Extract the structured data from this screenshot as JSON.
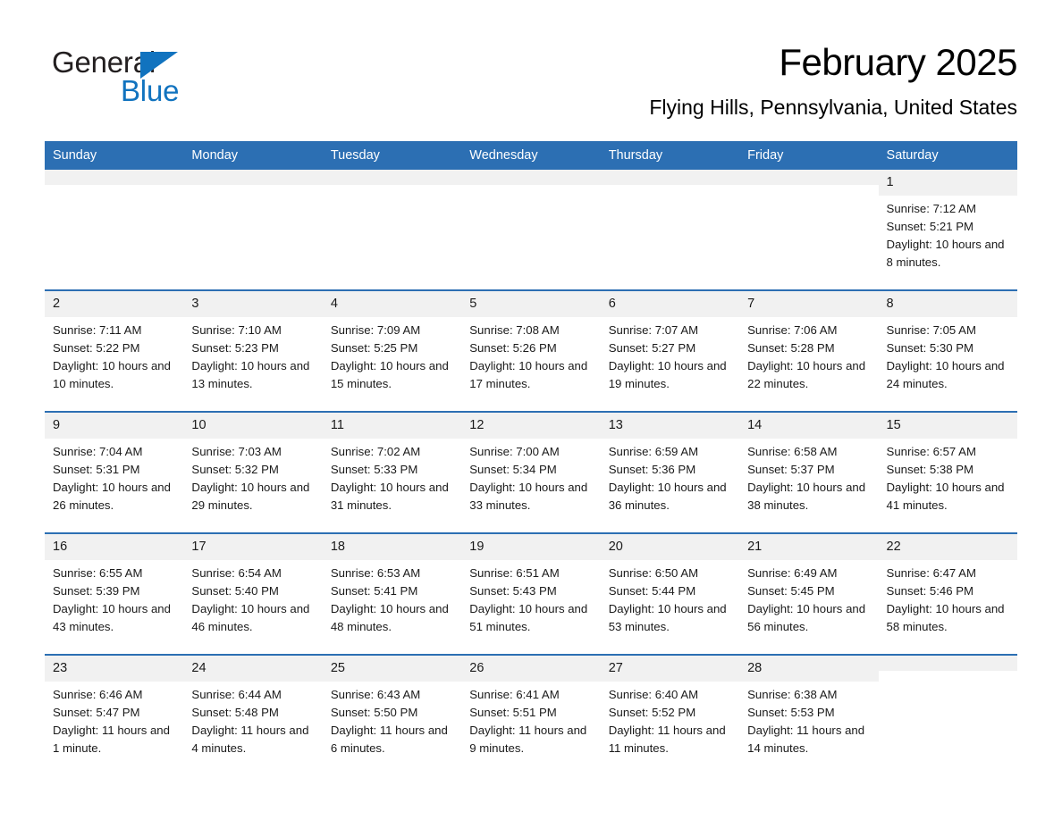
{
  "brand": {
    "name_part1": "General",
    "name_part2": "Blue",
    "triangle_color": "#1173bf",
    "text_color": "#231f20"
  },
  "header": {
    "title": "February 2025",
    "subtitle": "Flying Hills, Pennsylvania, United States"
  },
  "theme": {
    "header_blue": "#2c6fb3",
    "row_divider_blue": "#2c6fb3",
    "daynum_background": "#f1f1f1",
    "page_background": "#ffffff"
  },
  "calendar": {
    "columns": [
      "Sunday",
      "Monday",
      "Tuesday",
      "Wednesday",
      "Thursday",
      "Friday",
      "Saturday"
    ],
    "labels": {
      "sunrise": "Sunrise:",
      "sunset": "Sunset:",
      "daylight": "Daylight:"
    },
    "weeks": [
      [
        {
          "day": "",
          "sunrise": "",
          "sunset": "",
          "daylight": ""
        },
        {
          "day": "",
          "sunrise": "",
          "sunset": "",
          "daylight": ""
        },
        {
          "day": "",
          "sunrise": "",
          "sunset": "",
          "daylight": ""
        },
        {
          "day": "",
          "sunrise": "",
          "sunset": "",
          "daylight": ""
        },
        {
          "day": "",
          "sunrise": "",
          "sunset": "",
          "daylight": ""
        },
        {
          "day": "",
          "sunrise": "",
          "sunset": "",
          "daylight": ""
        },
        {
          "day": "1",
          "sunrise": "Sunrise: 7:12 AM",
          "sunset": "Sunset: 5:21 PM",
          "daylight": "Daylight: 10 hours and 8 minutes."
        }
      ],
      [
        {
          "day": "2",
          "sunrise": "Sunrise: 7:11 AM",
          "sunset": "Sunset: 5:22 PM",
          "daylight": "Daylight: 10 hours and 10 minutes."
        },
        {
          "day": "3",
          "sunrise": "Sunrise: 7:10 AM",
          "sunset": "Sunset: 5:23 PM",
          "daylight": "Daylight: 10 hours and 13 minutes."
        },
        {
          "day": "4",
          "sunrise": "Sunrise: 7:09 AM",
          "sunset": "Sunset: 5:25 PM",
          "daylight": "Daylight: 10 hours and 15 minutes."
        },
        {
          "day": "5",
          "sunrise": "Sunrise: 7:08 AM",
          "sunset": "Sunset: 5:26 PM",
          "daylight": "Daylight: 10 hours and 17 minutes."
        },
        {
          "day": "6",
          "sunrise": "Sunrise: 7:07 AM",
          "sunset": "Sunset: 5:27 PM",
          "daylight": "Daylight: 10 hours and 19 minutes."
        },
        {
          "day": "7",
          "sunrise": "Sunrise: 7:06 AM",
          "sunset": "Sunset: 5:28 PM",
          "daylight": "Daylight: 10 hours and 22 minutes."
        },
        {
          "day": "8",
          "sunrise": "Sunrise: 7:05 AM",
          "sunset": "Sunset: 5:30 PM",
          "daylight": "Daylight: 10 hours and 24 minutes."
        }
      ],
      [
        {
          "day": "9",
          "sunrise": "Sunrise: 7:04 AM",
          "sunset": "Sunset: 5:31 PM",
          "daylight": "Daylight: 10 hours and 26 minutes."
        },
        {
          "day": "10",
          "sunrise": "Sunrise: 7:03 AM",
          "sunset": "Sunset: 5:32 PM",
          "daylight": "Daylight: 10 hours and 29 minutes."
        },
        {
          "day": "11",
          "sunrise": "Sunrise: 7:02 AM",
          "sunset": "Sunset: 5:33 PM",
          "daylight": "Daylight: 10 hours and 31 minutes."
        },
        {
          "day": "12",
          "sunrise": "Sunrise: 7:00 AM",
          "sunset": "Sunset: 5:34 PM",
          "daylight": "Daylight: 10 hours and 33 minutes."
        },
        {
          "day": "13",
          "sunrise": "Sunrise: 6:59 AM",
          "sunset": "Sunset: 5:36 PM",
          "daylight": "Daylight: 10 hours and 36 minutes."
        },
        {
          "day": "14",
          "sunrise": "Sunrise: 6:58 AM",
          "sunset": "Sunset: 5:37 PM",
          "daylight": "Daylight: 10 hours and 38 minutes."
        },
        {
          "day": "15",
          "sunrise": "Sunrise: 6:57 AM",
          "sunset": "Sunset: 5:38 PM",
          "daylight": "Daylight: 10 hours and 41 minutes."
        }
      ],
      [
        {
          "day": "16",
          "sunrise": "Sunrise: 6:55 AM",
          "sunset": "Sunset: 5:39 PM",
          "daylight": "Daylight: 10 hours and 43 minutes."
        },
        {
          "day": "17",
          "sunrise": "Sunrise: 6:54 AM",
          "sunset": "Sunset: 5:40 PM",
          "daylight": "Daylight: 10 hours and 46 minutes."
        },
        {
          "day": "18",
          "sunrise": "Sunrise: 6:53 AM",
          "sunset": "Sunset: 5:41 PM",
          "daylight": "Daylight: 10 hours and 48 minutes."
        },
        {
          "day": "19",
          "sunrise": "Sunrise: 6:51 AM",
          "sunset": "Sunset: 5:43 PM",
          "daylight": "Daylight: 10 hours and 51 minutes."
        },
        {
          "day": "20",
          "sunrise": "Sunrise: 6:50 AM",
          "sunset": "Sunset: 5:44 PM",
          "daylight": "Daylight: 10 hours and 53 minutes."
        },
        {
          "day": "21",
          "sunrise": "Sunrise: 6:49 AM",
          "sunset": "Sunset: 5:45 PM",
          "daylight": "Daylight: 10 hours and 56 minutes."
        },
        {
          "day": "22",
          "sunrise": "Sunrise: 6:47 AM",
          "sunset": "Sunset: 5:46 PM",
          "daylight": "Daylight: 10 hours and 58 minutes."
        }
      ],
      [
        {
          "day": "23",
          "sunrise": "Sunrise: 6:46 AM",
          "sunset": "Sunset: 5:47 PM",
          "daylight": "Daylight: 11 hours and 1 minute."
        },
        {
          "day": "24",
          "sunrise": "Sunrise: 6:44 AM",
          "sunset": "Sunset: 5:48 PM",
          "daylight": "Daylight: 11 hours and 4 minutes."
        },
        {
          "day": "25",
          "sunrise": "Sunrise: 6:43 AM",
          "sunset": "Sunset: 5:50 PM",
          "daylight": "Daylight: 11 hours and 6 minutes."
        },
        {
          "day": "26",
          "sunrise": "Sunrise: 6:41 AM",
          "sunset": "Sunset: 5:51 PM",
          "daylight": "Daylight: 11 hours and 9 minutes."
        },
        {
          "day": "27",
          "sunrise": "Sunrise: 6:40 AM",
          "sunset": "Sunset: 5:52 PM",
          "daylight": "Daylight: 11 hours and 11 minutes."
        },
        {
          "day": "28",
          "sunrise": "Sunrise: 6:38 AM",
          "sunset": "Sunset: 5:53 PM",
          "daylight": "Daylight: 11 hours and 14 minutes."
        },
        {
          "day": "",
          "sunrise": "",
          "sunset": "",
          "daylight": ""
        }
      ]
    ]
  }
}
